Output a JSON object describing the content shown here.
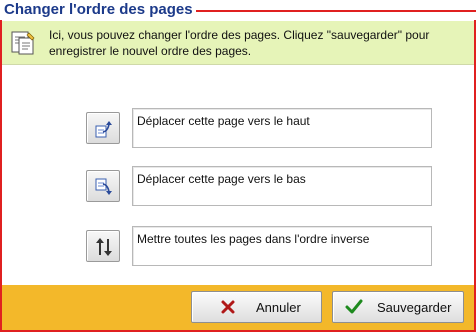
{
  "header": {
    "title": "Changer l'ordre des pages"
  },
  "info": {
    "icon": "document-edit-icon",
    "text": "Ici, vous pouvez changer l'ordre des pages.  Cliquez \"sauvegarder\" pour enregistrer le nouvel ordre des pages."
  },
  "actions": [
    {
      "icon": "move-up-icon",
      "label": "Déplacer cette page vers le haut"
    },
    {
      "icon": "move-down-icon",
      "label": "Déplacer cette page vers le bas"
    },
    {
      "icon": "reverse-order-icon",
      "label": "Mettre toutes les pages dans l'ordre inverse"
    }
  ],
  "footer": {
    "cancel_label": "Annuler",
    "save_label": "Sauvegarder"
  },
  "colors": {
    "title": "#1c3a8a",
    "border": "#e02020",
    "info_bg": "#e6f4b8",
    "footer_bg": "#f3b82a",
    "cancel_icon": "#b01818",
    "save_icon": "#1e8a1e"
  }
}
